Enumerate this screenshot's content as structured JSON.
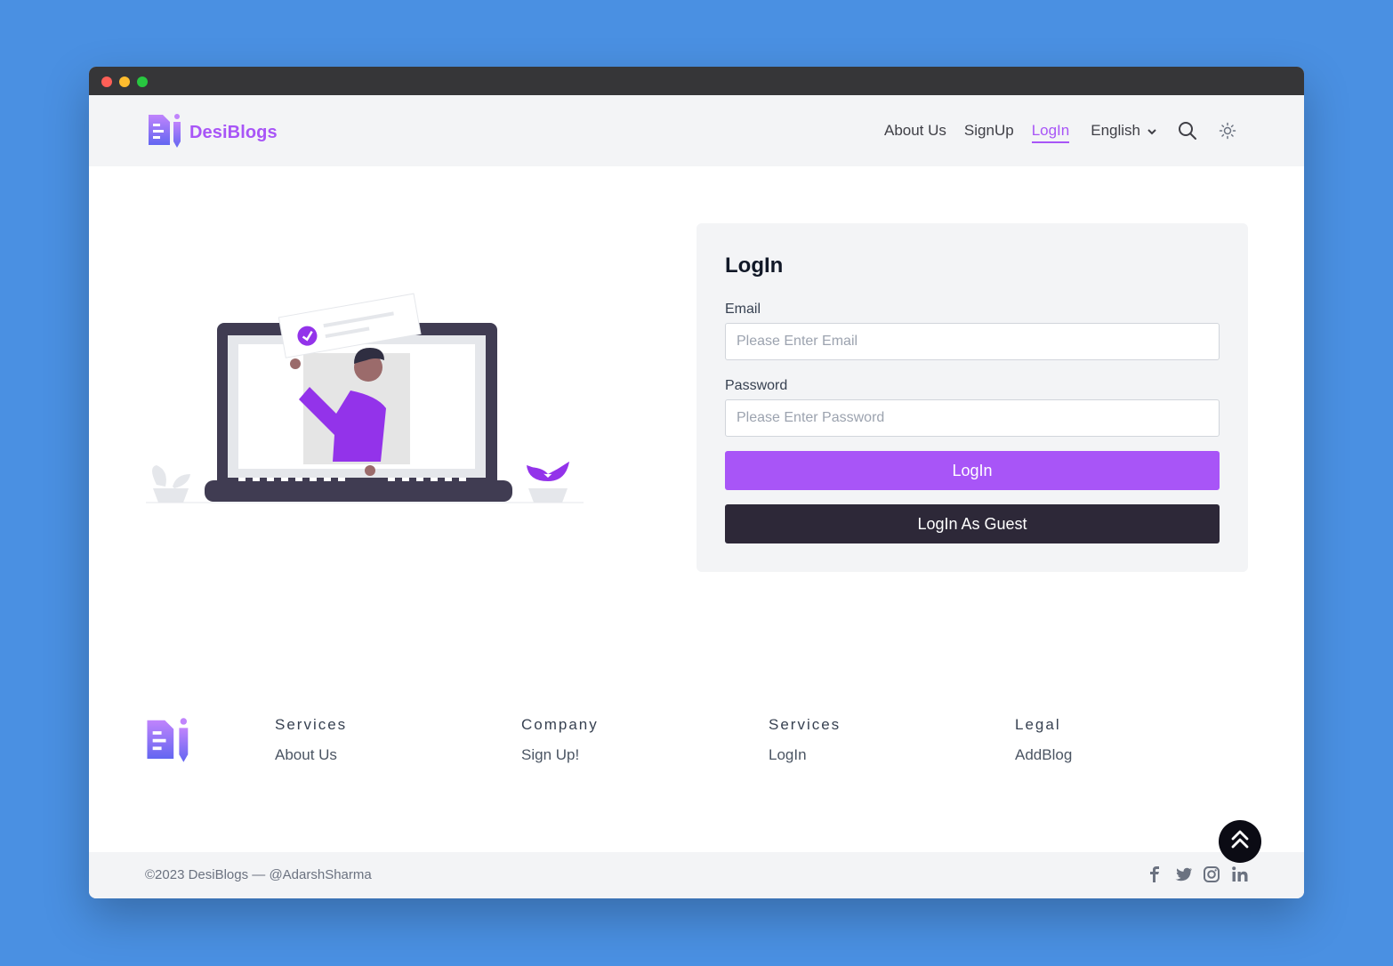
{
  "header": {
    "brand": "DesiBlogs",
    "nav": {
      "about": "About Us",
      "signup": "SignUp",
      "login": "LogIn"
    },
    "language": "English"
  },
  "login": {
    "title": "LogIn",
    "email_label": "Email",
    "email_placeholder": "Please Enter Email",
    "password_label": "Password",
    "password_placeholder": "Please Enter Password",
    "login_button": "LogIn",
    "guest_button": "LogIn As Guest"
  },
  "footer": {
    "columns": [
      {
        "heading": "Services",
        "link": "About Us"
      },
      {
        "heading": "Company",
        "link": "Sign Up!"
      },
      {
        "heading": "Services",
        "link": "LogIn"
      },
      {
        "heading": "Legal",
        "link": "AddBlog"
      }
    ],
    "copyright": "©2023 DesiBlogs — @AdarshSharma"
  },
  "colors": {
    "accent": "#a855f7",
    "dark_button": "#2d2838",
    "page_bg": "#4a90e2"
  },
  "icons": [
    "search-icon",
    "sun-icon",
    "chevron-down-icon",
    "facebook-icon",
    "twitter-icon",
    "instagram-icon",
    "linkedin-icon",
    "double-chevron-up-icon"
  ]
}
